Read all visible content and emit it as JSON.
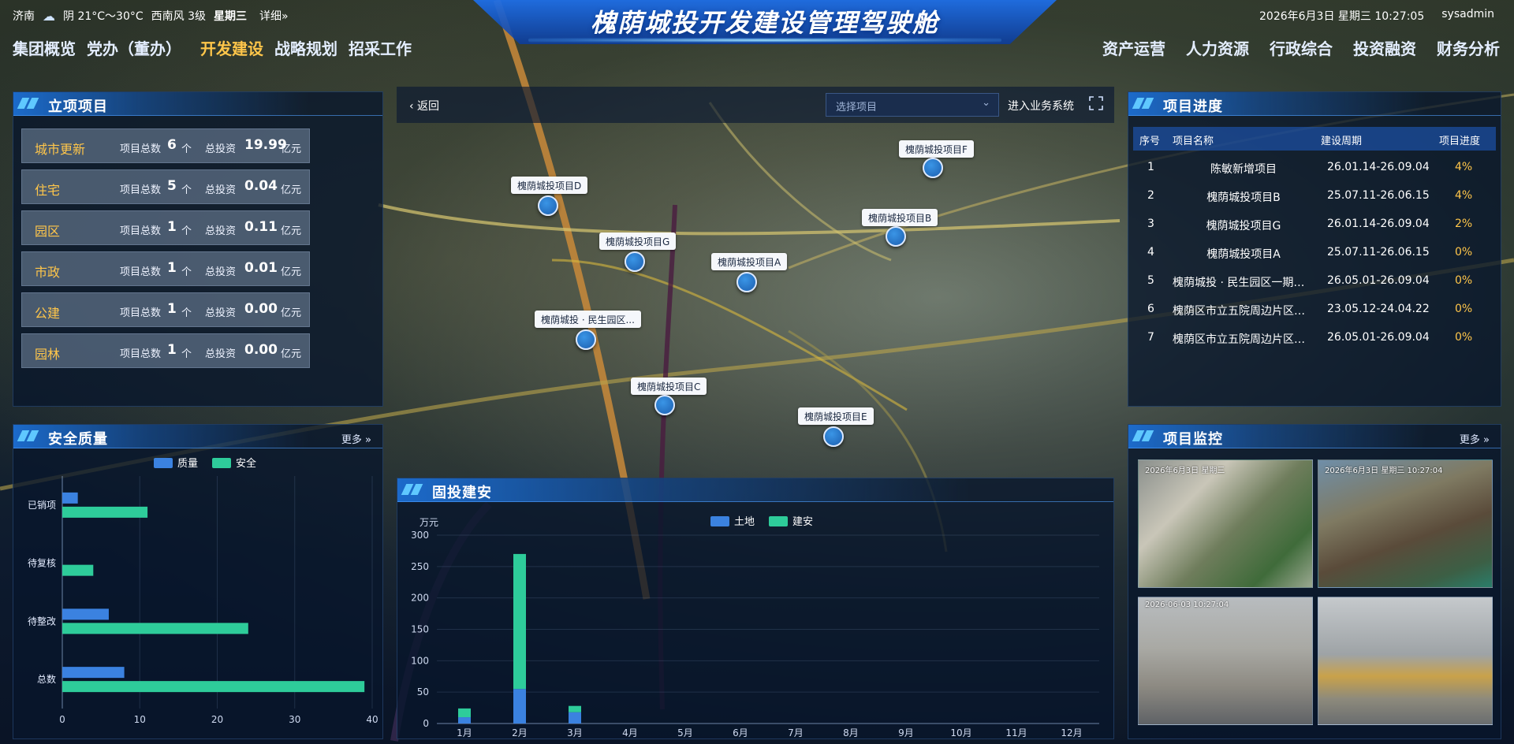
{
  "header": {
    "city": "济南",
    "weather": "阴 21°C～30°C",
    "wind": "西南风 3级",
    "weekday": "星期三",
    "detail_link": "详细»",
    "title": "槐荫城投开发建设管理驾驶舱",
    "datetime": "2026年6月3日 星期三 10:27:05",
    "user": "sysadmin"
  },
  "nav": {
    "left": [
      "集团概览",
      "党办（董办）",
      "开发建设",
      "战略规划",
      "招采工作"
    ],
    "right": [
      "资产运营",
      "人力资源",
      "行政综合",
      "投资融资",
      "财务分析"
    ],
    "active": "开发建设"
  },
  "projects": {
    "title": "立项项目",
    "count_label": "项目总数",
    "count_unit": "个",
    "invest_label": "总投资",
    "invest_unit": "亿元",
    "rows": [
      {
        "name": "城市更新",
        "count": "6",
        "invest": "19.99"
      },
      {
        "name": "住宅",
        "count": "5",
        "invest": "0.04"
      },
      {
        "name": "园区",
        "count": "1",
        "invest": "0.11"
      },
      {
        "name": "市政",
        "count": "1",
        "invest": "0.01"
      },
      {
        "name": "公建",
        "count": "1",
        "invest": "0.00"
      },
      {
        "name": "园林",
        "count": "1",
        "invest": "0.00"
      }
    ]
  },
  "map": {
    "back": "‹ 返回",
    "select_placeholder": "选择项目",
    "enter_system": "进入业务系统",
    "markers": [
      {
        "label": "槐荫城投项目D"
      },
      {
        "label": "槐荫城投项目F"
      },
      {
        "label": "槐荫城投项目B"
      },
      {
        "label": "槐荫城投项目G"
      },
      {
        "label": "槐荫城投项目A"
      },
      {
        "label": "槐荫城投 · 民生园区..."
      },
      {
        "label": "槐荫城投项目C"
      },
      {
        "label": "槐荫城投项目E"
      }
    ]
  },
  "progress": {
    "title": "项目进度",
    "headers": [
      "序号",
      "项目名称",
      "建设周期",
      "项目进度"
    ],
    "rows": [
      {
        "no": "1",
        "name": "陈敏新增项目",
        "period": "26.01.14-26.09.04",
        "pct": "4%"
      },
      {
        "no": "2",
        "name": "槐荫城投项目B",
        "period": "25.07.11-26.06.15",
        "pct": "4%"
      },
      {
        "no": "3",
        "name": "槐荫城投项目G",
        "period": "26.01.14-26.09.04",
        "pct": "2%"
      },
      {
        "no": "4",
        "name": "槐荫城投项目A",
        "period": "25.07.11-26.06.15",
        "pct": "0%"
      },
      {
        "no": "5",
        "name": "槐荫城投 · 民生园区一期社...",
        "period": "26.05.01-26.09.04",
        "pct": "0%"
      },
      {
        "no": "6",
        "name": "槐荫区市立五院周边片区二...",
        "period": "23.05.12-24.04.22",
        "pct": "0%"
      },
      {
        "no": "7",
        "name": "槐荫区市立五院周边片区二...",
        "period": "26.05.01-26.09.04",
        "pct": "0%"
      }
    ]
  },
  "safety": {
    "title": "安全质量",
    "more": "更多 »"
  },
  "fixed_invest": {
    "title": "固投建安"
  },
  "monitor": {
    "title": "项目监控",
    "more": "更多 »",
    "cams": [
      {
        "ts": "2026年6月3日 星期三"
      },
      {
        "ts": "2026年6月3日 星期三 10:27:04"
      },
      {
        "ts": "2026-06-03 10:27:04"
      },
      {
        "ts": ""
      }
    ]
  },
  "chart_data": [
    {
      "type": "bar",
      "orientation": "horizontal",
      "categories": [
        "总数",
        "待整改",
        "待复核",
        "已销项"
      ],
      "series": [
        {
          "name": "质量",
          "values": [
            8,
            6,
            0,
            2
          ],
          "color": "#3b82e0"
        },
        {
          "name": "安全",
          "values": [
            39,
            24,
            4,
            11
          ],
          "color": "#2ecc9a"
        }
      ],
      "xlim": [
        0,
        40
      ],
      "xticks": [
        0,
        10,
        20,
        30,
        40
      ],
      "legend": "top-center",
      "grid": true
    },
    {
      "type": "bar",
      "stacked": true,
      "categories": [
        "1月",
        "2月",
        "3月",
        "4月",
        "5月",
        "6月",
        "7月",
        "8月",
        "9月",
        "10月",
        "11月",
        "12月"
      ],
      "series": [
        {
          "name": "土地",
          "values": [
            10,
            55,
            18,
            0,
            0,
            0,
            0,
            0,
            0,
            0,
            0,
            0
          ],
          "color": "#3b82e0"
        },
        {
          "name": "建安",
          "values": [
            14,
            215,
            10,
            0,
            0,
            0,
            0,
            0,
            0,
            0,
            0,
            0
          ],
          "color": "#2ecc9a"
        }
      ],
      "ylabel": "万元",
      "ylim": [
        0,
        300
      ],
      "yticks": [
        0,
        50,
        100,
        150,
        200,
        250,
        300
      ],
      "legend": "top-center",
      "grid": true
    }
  ]
}
